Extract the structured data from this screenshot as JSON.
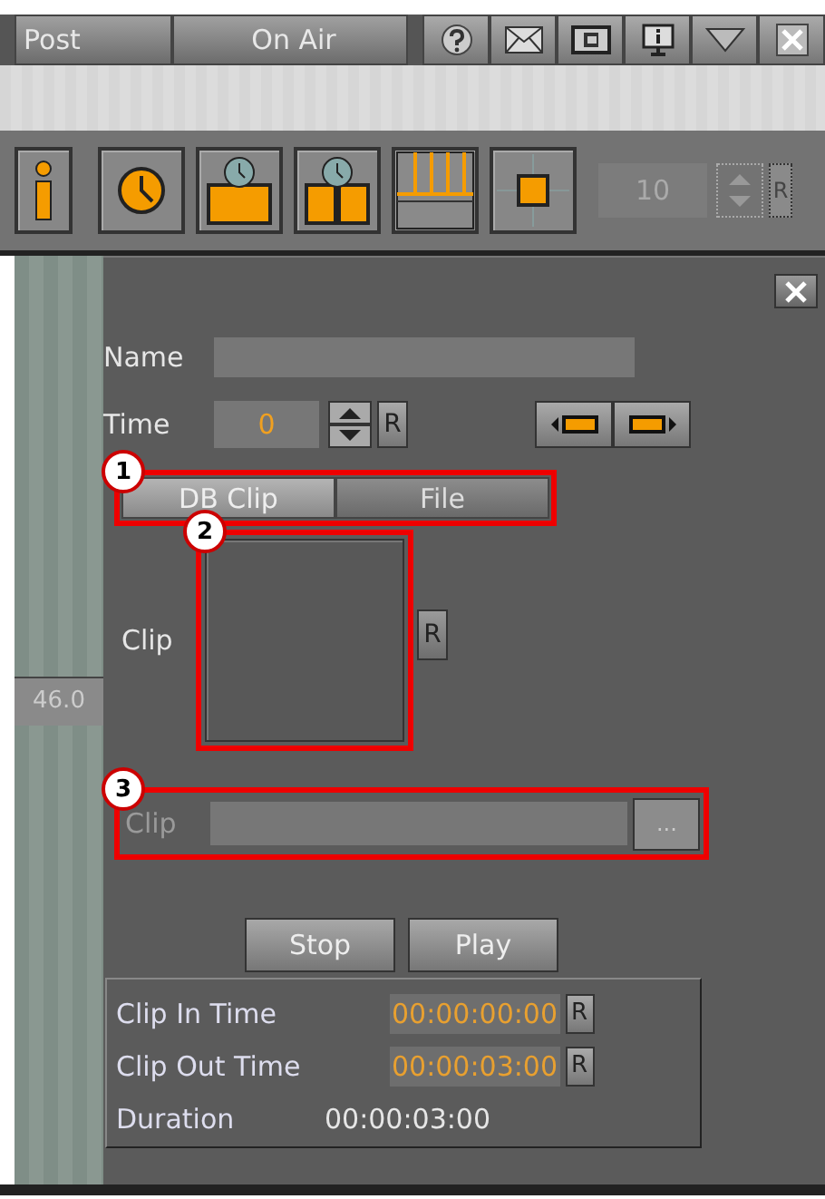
{
  "header_tabs": [
    {
      "label": "Post",
      "selected": false
    },
    {
      "label": "On Air",
      "selected": false
    }
  ],
  "toolbar": {
    "counter": "10",
    "reset": "R"
  },
  "side_ruler": {
    "reading": "46.0"
  },
  "editor": {
    "name": {
      "label": "Name"
    },
    "time": {
      "label": "Time",
      "value": "0",
      "reset": "R"
    },
    "source_tabs": [
      {
        "label": "DB Clip",
        "selected": true
      },
      {
        "label": "File",
        "selected": false
      }
    ],
    "clip_db": {
      "label": "Clip",
      "reset": "R"
    },
    "clip_file": {
      "label": "Clip",
      "disabled": true,
      "browse": "..."
    },
    "buttons": [
      "Stop",
      "Play"
    ],
    "timing": [
      {
        "label": "Clip In Time",
        "value": "00:00:00:00",
        "kind": "editable",
        "reset": "R"
      },
      {
        "label": "Clip Out Time",
        "value": "00:00:03:00",
        "kind": "editable",
        "reset": "R"
      },
      {
        "label": "Duration",
        "value": "00:00:03:00",
        "kind": "readonly"
      }
    ]
  },
  "annotations": [
    "1",
    "2",
    "3"
  ]
}
